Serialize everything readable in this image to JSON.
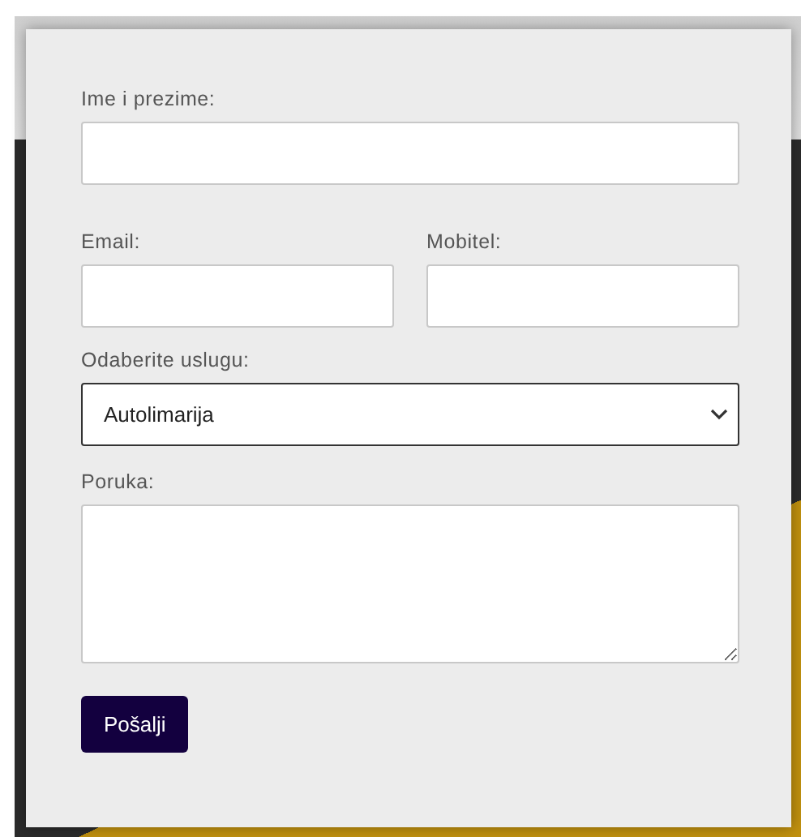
{
  "form": {
    "rows": [
      {
        "fields": [
          {
            "label": "Ime i prezime:",
            "kind": "text"
          }
        ]
      },
      {
        "fields": [
          {
            "label": "Email:",
            "kind": "text"
          },
          {
            "label": "Mobitel:",
            "kind": "text"
          }
        ]
      },
      {
        "fields": [
          {
            "label": "Odaberite uslugu:",
            "kind": "select",
            "value": "Autolimarija"
          }
        ]
      },
      {
        "fields": [
          {
            "label": "Poruka:",
            "kind": "textarea"
          }
        ]
      }
    ],
    "submit": "Pošalji"
  }
}
